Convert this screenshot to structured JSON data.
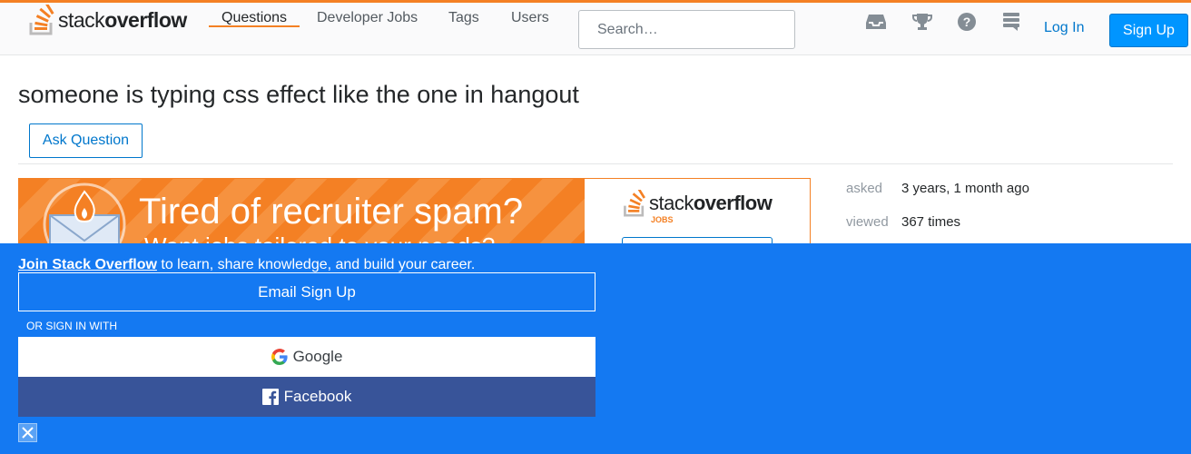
{
  "header": {
    "logo": {
      "light": "stack",
      "bold": "overflow"
    },
    "nav": [
      {
        "label": "Questions"
      },
      {
        "label": "Developer Jobs"
      },
      {
        "label": "Tags"
      },
      {
        "label": "Users"
      }
    ],
    "search_placeholder": "Search…",
    "icons": [
      "inbox-icon",
      "achievements-icon",
      "help-icon",
      "site-switcher-icon"
    ],
    "login_label": "Log In",
    "signup_label": "Sign Up"
  },
  "question": {
    "title": "someone is typing css effect like the one in hangout",
    "ask_button": "Ask Question"
  },
  "ad": {
    "headline": "Tired of recruiter spam?",
    "subline": "Want jobs tailored to your needs?",
    "logo_light": "stack",
    "logo_bold": "overflow",
    "jobs_label": "JOBS"
  },
  "meta": {
    "asked_label": "asked",
    "asked_value": "3 years, 1 month ago",
    "viewed_label": "viewed",
    "viewed_value": "367 times"
  },
  "signup_banner": {
    "join_link": "Join Stack Overflow",
    "join_rest": " to learn, share knowledge, and build your career.",
    "email_button": "Email Sign Up",
    "or_text": "OR SIGN IN WITH",
    "google_button": "Google",
    "facebook_button": "Facebook"
  },
  "colors": {
    "accent_orange": "#f48024",
    "link_blue": "#0077cc",
    "banner_blue": "#1479f2",
    "facebook_blue": "#385499"
  }
}
